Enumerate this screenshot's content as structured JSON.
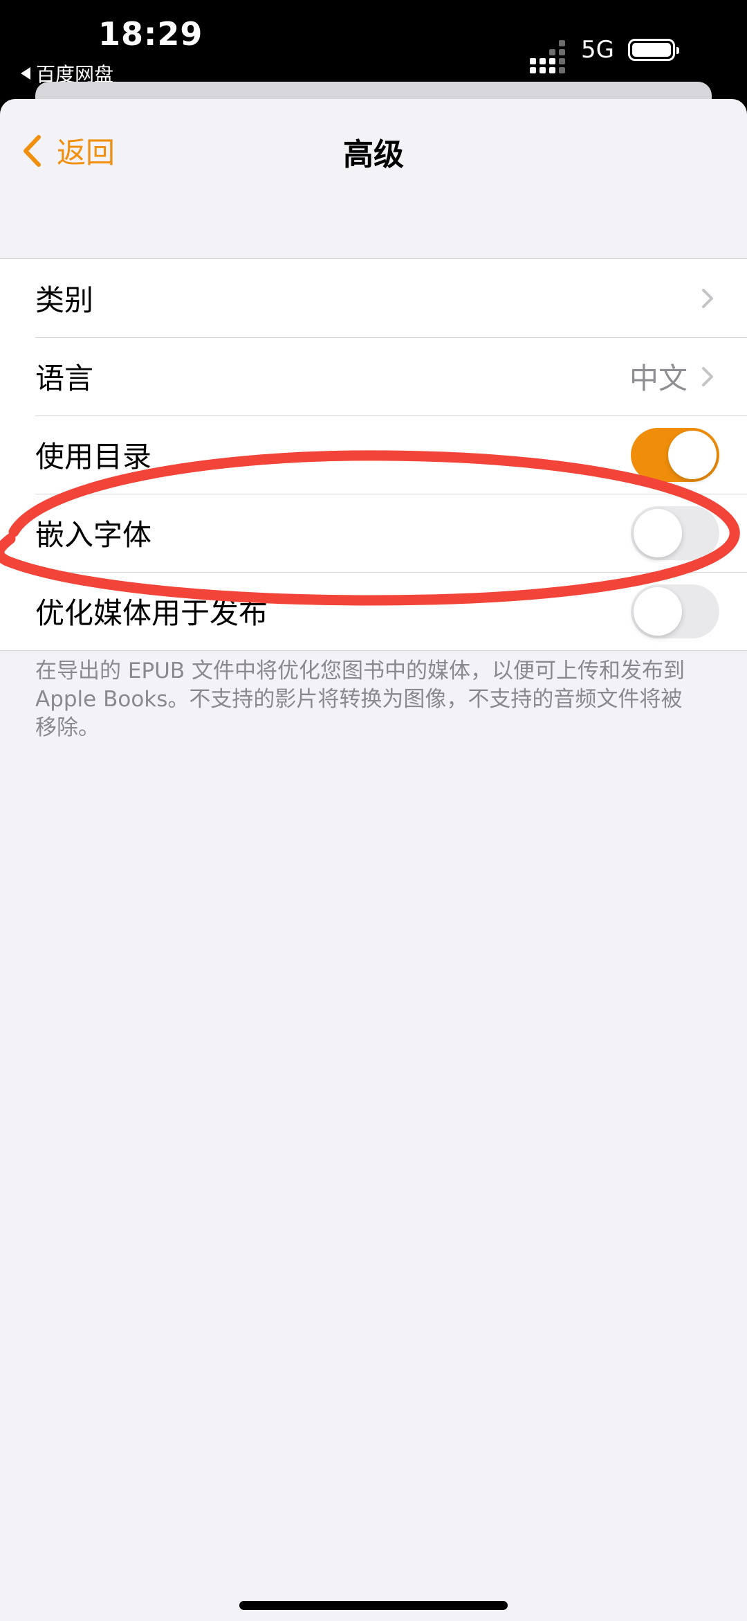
{
  "status_bar": {
    "time": "18:29",
    "back_app": "百度网盘",
    "network": "5G"
  },
  "nav": {
    "back_label": "返回",
    "title": "高级"
  },
  "rows": [
    {
      "label": "类别",
      "value": "",
      "control": "chevron"
    },
    {
      "label": "语言",
      "value": "中文",
      "control": "chevron"
    },
    {
      "label": "使用目录",
      "control": "toggle",
      "on": true
    },
    {
      "label": "嵌入字体",
      "control": "toggle",
      "on": false
    },
    {
      "label": "优化媒体用于发布",
      "control": "toggle",
      "on": false
    }
  ],
  "footnote": "在导出的 EPUB 文件中将优化您图书中的媒体，以便可上传和发布到 Apple Books。不支持的影片将转换为图像，不支持的音频文件将被移除。",
  "colors": {
    "accent": "#f08e0b",
    "annotation": "#f24438"
  }
}
